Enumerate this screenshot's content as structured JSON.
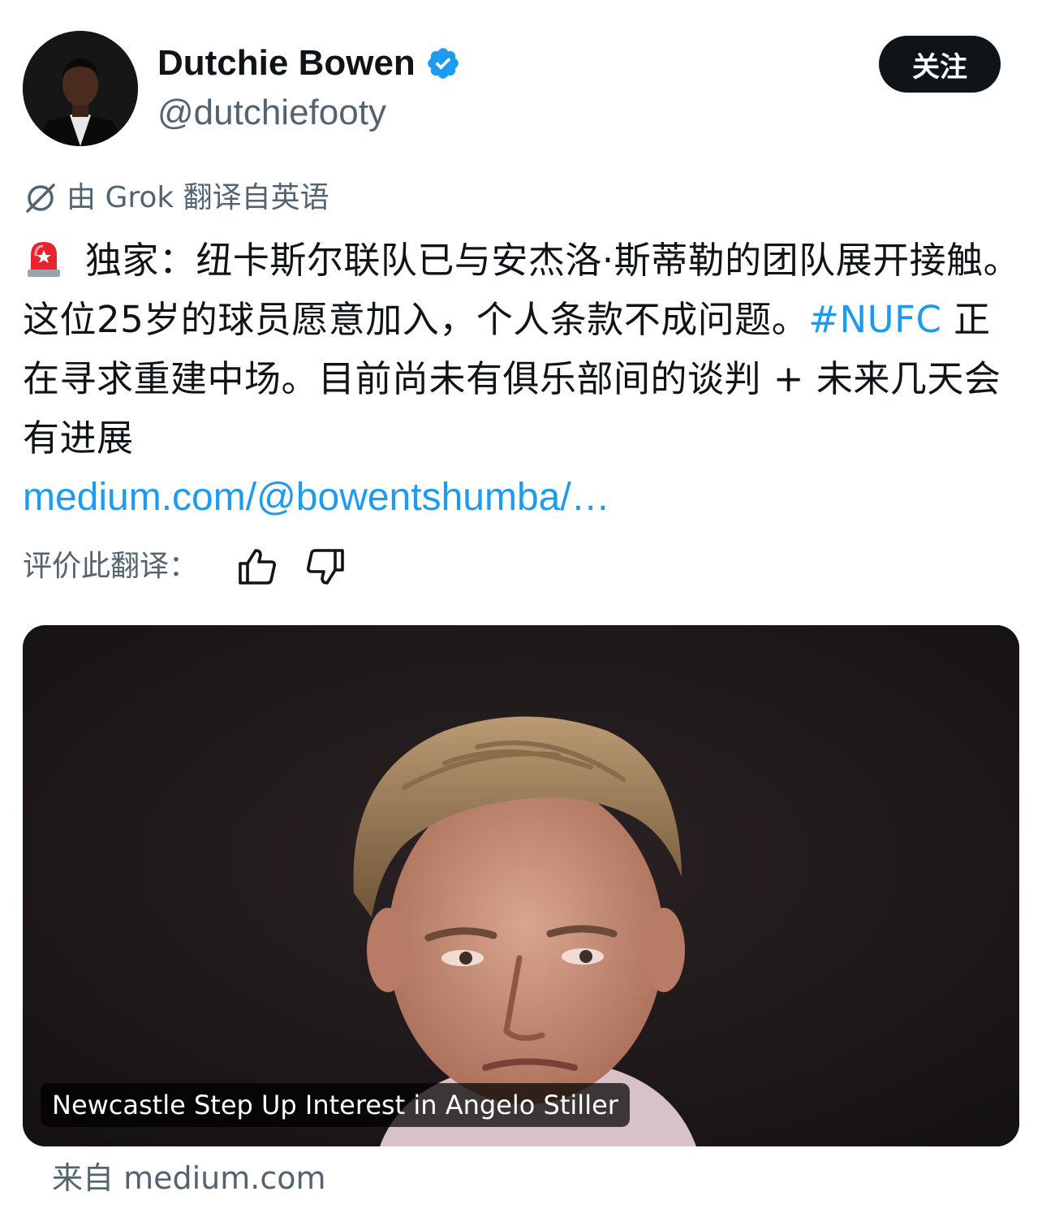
{
  "author": {
    "display_name": "Dutchie Bowen",
    "handle": "@dutchiefooty",
    "verified_icon": "verified-badge-icon"
  },
  "follow_label": "关注",
  "translation_notice": "由 Grok 翻译自英语",
  "tweet": {
    "text_part1": "独家：纽卡斯尔联队已与安杰洛·斯蒂勒的团队展开接触。这位25岁的球员愿意加入，个人条款不成问题。",
    "hashtag": "#NUFC",
    "text_part2": " 正在寻求重建中场。目前尚未有俱乐部间的谈判 + 未来几天会有进展",
    "link": "medium.com/@bowentshumba/…"
  },
  "rating": {
    "label": "评价此翻译："
  },
  "card": {
    "title": "Newcastle Step Up Interest in Angelo Stiller",
    "source": "来自 medium.com"
  },
  "colors": {
    "link": "#1d9bf0",
    "secondary_text": "#536471",
    "primary_text": "#0f1419"
  }
}
